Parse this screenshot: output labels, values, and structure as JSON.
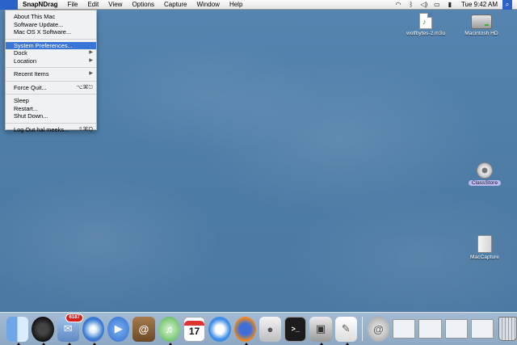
{
  "menubar": {
    "apple_glyph": "",
    "app_name": "SnapNDrag",
    "menus": [
      "File",
      "Edit",
      "View",
      "Options",
      "Capture",
      "Window",
      "Help"
    ],
    "clock": "Tue 9:42 AM"
  },
  "apple_menu": {
    "items": [
      {
        "label": "About This Mac",
        "shortcut": ""
      },
      {
        "label": "Software Update...",
        "shortcut": ""
      },
      {
        "label": "Mac OS X Software...",
        "shortcut": ""
      },
      {
        "label": "System Preferences...",
        "shortcut": "",
        "highlighted": true
      },
      {
        "label": "Dock",
        "shortcut": "",
        "submenu": true
      },
      {
        "label": "Location",
        "shortcut": "",
        "submenu": true
      },
      {
        "label": "Recent Items",
        "shortcut": "",
        "submenu": true
      },
      {
        "label": "Force Quit...",
        "shortcut": "⌥⌘⎋"
      },
      {
        "label": "Sleep",
        "shortcut": ""
      },
      {
        "label": "Restart...",
        "shortcut": ""
      },
      {
        "label": "Shut Down...",
        "shortcut": ""
      },
      {
        "label": "Log Out hal meeks...",
        "shortcut": "⇧⌘Q"
      }
    ]
  },
  "desktop_icons": {
    "file": "wolfbytes-2.m3u",
    "hd": "Macintosh HD",
    "classstore": "ClassStore",
    "maccapture": "MacCapture"
  },
  "dock": {
    "mail_badge": "6187",
    "calendar_day": "17",
    "items": [
      "finder-icon",
      "dashboard-icon",
      "mail-icon",
      "safari-icon",
      "ichat-icon",
      "address-book-icon",
      "itunes-icon",
      "ical-icon",
      "quicktime-icon",
      "firefox-icon",
      "preview-icon",
      "terminal-icon",
      "snapndrag-icon",
      "textedit-icon",
      "downloads-icon",
      "trash-icon"
    ]
  },
  "colors": {
    "accent": "#3875d7",
    "desktop": "#4f7ea8"
  }
}
